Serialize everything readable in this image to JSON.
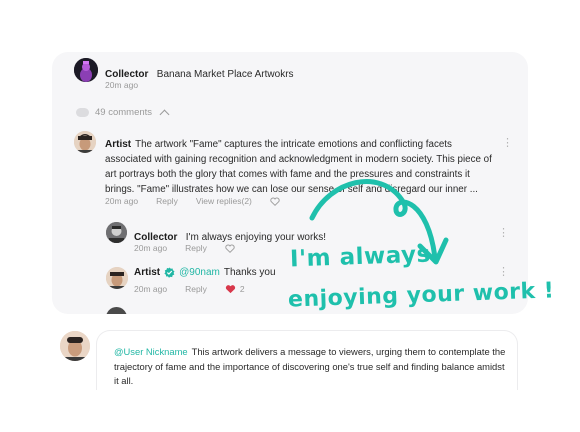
{
  "thread": {
    "post": {
      "author": "Collector",
      "title": "Banana Market Place Artwokrs",
      "time": "20m ago"
    },
    "comments_count_label": "49 comments",
    "comments": [
      {
        "author": "Artist",
        "text": "The artwork \"Fame\" captures the intricate emotions and conflicting facets associated with gaining recognition and acknowledgment in modern society. This piece of art portrays both the glory that comes with fame and the pressures and constraints it brings. \"Fame\" illustrates how we can lose our sense of self and disregard our inner ...",
        "time": "20m ago",
        "reply_label": "Reply",
        "view_replies_label": "View replies(2)",
        "replies": [
          {
            "author": "Collector",
            "text": "I'm always enjoying your works!",
            "time": "20m ago",
            "reply_label": "Reply"
          },
          {
            "author": "Artist",
            "mention": "@90nam",
            "text": "Thanks you",
            "time": "20m ago",
            "reply_label": "Reply",
            "likes": "2"
          }
        ]
      }
    ]
  },
  "composer": {
    "mention": "@User Nickname",
    "text": "This artwork delivers a message to viewers, urging them to contemplate the trajectory of fame and the importance of discovering one's true self and finding balance amidst it all."
  },
  "annotation": {
    "line1": "I'm always",
    "line2": "enjoying your work !"
  },
  "colors": {
    "accent": "#22b7a5",
    "heart_filled": "#d8384b",
    "panel_bg": "#f6f6f8"
  }
}
